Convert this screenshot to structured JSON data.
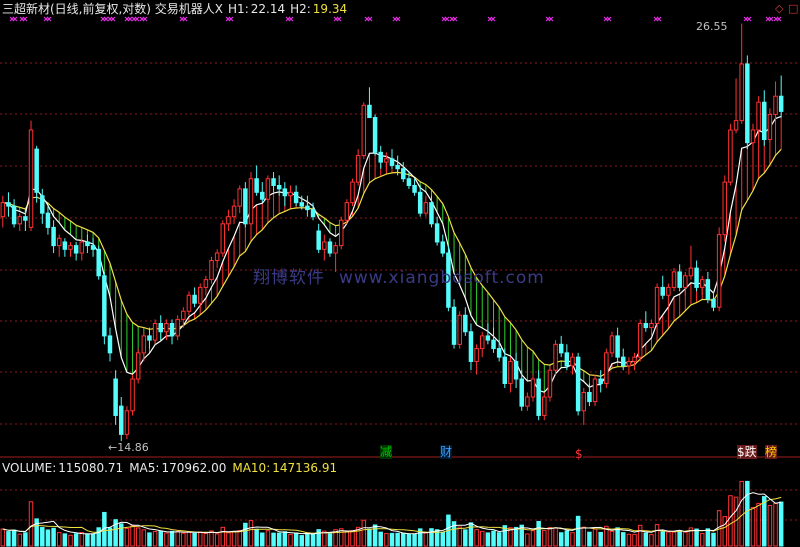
{
  "header": {
    "title": "三超新材(日线,前复权,对数) 交易机器人X",
    "h1_label": "H1:",
    "h1_value": "22.14",
    "h2_label": "H2:",
    "h2_value": "19.34"
  },
  "corner_icons": [
    "diamond-icon",
    "square-icon"
  ],
  "price_marks": {
    "high_label": "26.55",
    "low_label": "14.86",
    "low_arrow": "←"
  },
  "signal_tags": [
    {
      "text": "减",
      "color": "#00c000",
      "bg": "#003300"
    },
    {
      "text": "财",
      "color": "#3aa0ff",
      "bg": "#001a33"
    },
    {
      "text": "$",
      "color": "#ff3030",
      "bg": "#000000"
    },
    {
      "text": "$跌",
      "color": "#ffffff",
      "bg": "#6a1a1a"
    },
    {
      "text": "榜",
      "color": "#ffcc00",
      "bg": "#6a1a1a"
    }
  ],
  "volume_header": {
    "vol_label": "VOLUME:",
    "vol_value": "115080.71",
    "ma5_label": "MA5:",
    "ma5_value": "170962.00",
    "ma10_label": "MA10:",
    "ma10_value": "147136.91"
  },
  "watermark": {
    "cn": "翔博软件",
    "url": "www.xiangbosoft.com"
  },
  "colors": {
    "up": "#ff3232",
    "down": "#54fcfc",
    "fast_ma": "#ffffff",
    "slow_ma": "#f0e040",
    "fill_up": "#ff3030",
    "fill_down": "#30d030",
    "grid": "#8a1a1a",
    "cross": "#e030e0"
  },
  "chart_data": {
    "type": "candlestick",
    "title": "三超新材(日线,前复权,对数)",
    "ohlc": [
      [
        20.3,
        20.9,
        20.0,
        20.7
      ],
      [
        20.7,
        21.0,
        20.3,
        20.6
      ],
      [
        20.6,
        20.8,
        20.0,
        20.1
      ],
      [
        20.1,
        20.4,
        19.9,
        20.3
      ],
      [
        20.3,
        20.5,
        19.9,
        20.2
      ],
      [
        20.0,
        23.2,
        19.9,
        22.9
      ],
      [
        22.3,
        22.4,
        20.7,
        21.0
      ],
      [
        20.9,
        21.1,
        20.1,
        20.4
      ],
      [
        20.4,
        20.6,
        19.8,
        20.0
      ],
      [
        20.0,
        20.2,
        19.3,
        19.5
      ],
      [
        19.5,
        19.8,
        19.2,
        19.7
      ],
      [
        19.6,
        19.7,
        19.2,
        19.4
      ],
      [
        19.4,
        19.6,
        19.2,
        19.5
      ],
      [
        19.5,
        19.6,
        19.1,
        19.3
      ],
      [
        19.3,
        19.7,
        19.1,
        19.6
      ],
      [
        19.6,
        19.8,
        19.3,
        19.5
      ],
      [
        19.5,
        19.7,
        19.2,
        19.4
      ],
      [
        19.4,
        19.5,
        18.6,
        18.7
      ],
      [
        18.7,
        18.8,
        17.0,
        17.2
      ],
      [
        17.2,
        17.4,
        16.6,
        16.8
      ],
      [
        16.2,
        16.4,
        15.2,
        15.4
      ],
      [
        15.6,
        15.8,
        14.86,
        15.0
      ],
      [
        15.0,
        15.6,
        14.9,
        15.5
      ],
      [
        15.5,
        16.3,
        15.4,
        16.2
      ],
      [
        16.2,
        16.9,
        16.1,
        16.8
      ],
      [
        16.8,
        17.3,
        16.6,
        17.2
      ],
      [
        17.2,
        17.4,
        16.9,
        17.1
      ],
      [
        17.1,
        17.6,
        17.0,
        17.5
      ],
      [
        17.5,
        17.7,
        17.1,
        17.3
      ],
      [
        17.3,
        17.6,
        17.1,
        17.5
      ],
      [
        17.5,
        17.6,
        17.0,
        17.2
      ],
      [
        17.2,
        17.7,
        17.1,
        17.6
      ],
      [
        17.6,
        17.9,
        17.4,
        17.8
      ],
      [
        17.8,
        18.3,
        17.7,
        18.2
      ],
      [
        18.2,
        18.4,
        17.9,
        18.0
      ],
      [
        18.0,
        18.5,
        17.9,
        18.4
      ],
      [
        18.4,
        18.7,
        18.2,
        18.6
      ],
      [
        18.6,
        19.2,
        18.5,
        19.1
      ],
      [
        19.1,
        19.4,
        18.9,
        19.3
      ],
      [
        19.3,
        20.2,
        19.2,
        20.1
      ],
      [
        20.1,
        20.5,
        19.9,
        20.3
      ],
      [
        20.3,
        20.8,
        20.1,
        20.6
      ],
      [
        20.6,
        21.2,
        20.4,
        21.1
      ],
      [
        21.1,
        21.3,
        20.0,
        20.1
      ],
      [
        20.1,
        21.6,
        20.0,
        21.4
      ],
      [
        21.4,
        21.8,
        20.9,
        21.0
      ],
      [
        21.0,
        21.3,
        20.7,
        20.8
      ],
      [
        20.8,
        21.5,
        20.7,
        21.4
      ],
      [
        21.4,
        21.6,
        21.0,
        21.2
      ],
      [
        21.2,
        21.5,
        20.9,
        21.1
      ],
      [
        21.1,
        21.3,
        20.6,
        20.9
      ],
      [
        20.9,
        21.2,
        20.7,
        21.0
      ],
      [
        21.0,
        21.2,
        20.6,
        20.7
      ],
      [
        20.7,
        20.9,
        20.5,
        20.6
      ],
      [
        20.6,
        20.9,
        20.3,
        20.5
      ],
      [
        20.5,
        20.7,
        20.2,
        20.3
      ],
      [
        19.9,
        20.1,
        19.3,
        19.4
      ],
      [
        19.4,
        19.8,
        19.1,
        19.6
      ],
      [
        19.6,
        19.7,
        19.2,
        19.3
      ],
      [
        19.3,
        19.6,
        18.8,
        19.5
      ],
      [
        19.5,
        20.3,
        19.4,
        20.2
      ],
      [
        20.2,
        20.8,
        20.1,
        20.7
      ],
      [
        20.7,
        21.4,
        20.6,
        21.3
      ],
      [
        21.3,
        22.3,
        21.2,
        22.1
      ],
      [
        22.1,
        23.8,
        22.0,
        23.7
      ],
      [
        23.7,
        24.3,
        23.3,
        23.3
      ],
      [
        23.3,
        23.4,
        22.1,
        22.2
      ],
      [
        22.2,
        22.4,
        21.7,
        21.9
      ],
      [
        21.9,
        22.2,
        21.6,
        22.0
      ],
      [
        22.0,
        22.3,
        21.7,
        21.8
      ],
      [
        21.8,
        22.1,
        21.5,
        21.7
      ],
      [
        21.7,
        21.9,
        21.3,
        21.4
      ],
      [
        21.4,
        21.6,
        21.1,
        21.2
      ],
      [
        21.2,
        21.4,
        20.9,
        21.0
      ],
      [
        21.0,
        21.2,
        20.3,
        20.4
      ],
      [
        20.4,
        20.9,
        20.3,
        20.7
      ],
      [
        20.7,
        20.9,
        20.0,
        20.1
      ],
      [
        20.1,
        20.3,
        19.5,
        19.6
      ],
      [
        19.6,
        19.8,
        19.2,
        19.3
      ],
      [
        19.3,
        19.5,
        17.8,
        17.9
      ],
      [
        17.9,
        18.1,
        16.9,
        17.0
      ],
      [
        17.0,
        17.8,
        16.9,
        17.7
      ],
      [
        17.7,
        17.9,
        17.2,
        17.3
      ],
      [
        17.3,
        17.5,
        16.4,
        16.6
      ],
      [
        16.6,
        17.0,
        16.3,
        16.9
      ],
      [
        16.9,
        17.3,
        16.7,
        17.2
      ],
      [
        17.2,
        17.5,
        17.0,
        17.1
      ],
      [
        17.1,
        17.4,
        16.8,
        16.9
      ],
      [
        16.9,
        17.1,
        16.6,
        16.7
      ],
      [
        16.7,
        16.9,
        16.0,
        16.1
      ],
      [
        16.1,
        16.7,
        15.9,
        16.6
      ],
      [
        16.6,
        16.8,
        16.0,
        16.2
      ],
      [
        16.2,
        16.4,
        15.5,
        15.6
      ],
      [
        15.6,
        15.9,
        15.5,
        15.8
      ],
      [
        15.8,
        16.3,
        15.7,
        16.2
      ],
      [
        16.2,
        16.4,
        15.3,
        15.4
      ],
      [
        15.4,
        15.9,
        15.3,
        15.8
      ],
      [
        15.8,
        16.5,
        15.7,
        16.4
      ],
      [
        16.4,
        17.1,
        16.3,
        17.0
      ],
      [
        17.0,
        17.2,
        16.7,
        16.8
      ],
      [
        16.8,
        17.0,
        16.4,
        16.5
      ],
      [
        16.5,
        16.8,
        16.3,
        16.7
      ],
      [
        16.7,
        16.8,
        15.4,
        15.5
      ],
      [
        15.5,
        16.0,
        15.2,
        15.9
      ],
      [
        15.9,
        16.1,
        15.6,
        15.7
      ],
      [
        15.7,
        16.3,
        15.6,
        16.2
      ],
      [
        16.2,
        16.4,
        15.9,
        16.1
      ],
      [
        16.1,
        16.9,
        16.0,
        16.8
      ],
      [
        16.8,
        17.3,
        16.7,
        17.2
      ],
      [
        17.2,
        17.4,
        16.6,
        16.7
      ],
      [
        16.7,
        16.9,
        16.4,
        16.5
      ],
      [
        16.5,
        16.7,
        16.3,
        16.6
      ],
      [
        16.6,
        16.8,
        16.4,
        16.7
      ],
      [
        16.7,
        17.6,
        16.6,
        17.5
      ],
      [
        17.5,
        17.8,
        17.3,
        17.4
      ],
      [
        17.4,
        17.6,
        17.2,
        17.5
      ],
      [
        17.5,
        18.5,
        17.4,
        18.4
      ],
      [
        18.4,
        18.7,
        18.1,
        18.2
      ],
      [
        18.2,
        18.5,
        17.9,
        18.4
      ],
      [
        18.4,
        18.9,
        18.3,
        18.8
      ],
      [
        18.8,
        19.0,
        18.3,
        18.4
      ],
      [
        18.4,
        18.8,
        18.2,
        18.7
      ],
      [
        18.7,
        19.5,
        18.6,
        18.9
      ],
      [
        18.9,
        19.1,
        18.3,
        18.4
      ],
      [
        18.4,
        18.7,
        18.2,
        18.6
      ],
      [
        18.6,
        18.8,
        18.0,
        18.1
      ],
      [
        18.1,
        18.3,
        17.8,
        17.9
      ],
      [
        17.9,
        20.0,
        17.8,
        19.8
      ],
      [
        19.8,
        21.5,
        19.6,
        21.3
      ],
      [
        21.3,
        23.1,
        21.2,
        22.9
      ],
      [
        22.9,
        24.6,
        22.8,
        23.2
      ],
      [
        23.2,
        26.55,
        23.1,
        25.1
      ],
      [
        25.1,
        25.4,
        22.3,
        22.5
      ],
      [
        22.5,
        23.1,
        22.2,
        22.9
      ],
      [
        22.9,
        24.0,
        22.7,
        23.8
      ],
      [
        23.8,
        24.2,
        22.4,
        22.6
      ],
      [
        22.6,
        23.6,
        22.5,
        23.4
      ],
      [
        23.4,
        24.5,
        23.2,
        24.0
      ],
      [
        24.0,
        24.7,
        23.3,
        23.5
      ]
    ],
    "ma_fast_label": "H2",
    "ma_slow_label": "H1",
    "y_axis": "log",
    "volume": [
      115080.71
    ],
    "volume_ma5": 170962.0,
    "volume_ma10": 147136.91,
    "high": 26.55,
    "low": 14.86
  }
}
